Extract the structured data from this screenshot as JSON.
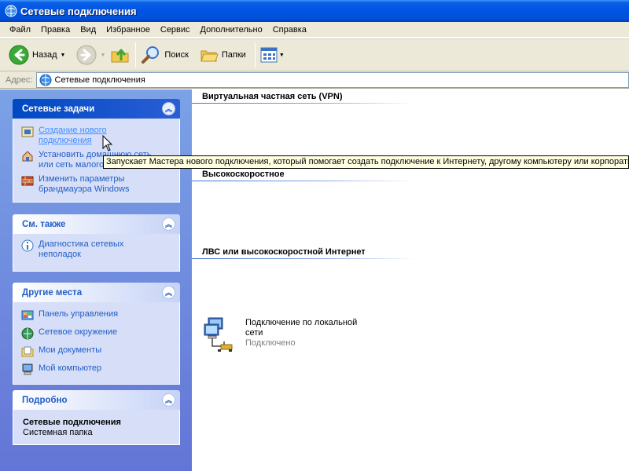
{
  "window": {
    "title": "Сетевые подключения"
  },
  "menu": [
    "Файл",
    "Правка",
    "Вид",
    "Избранное",
    "Сервис",
    "Дополнительно",
    "Справка"
  ],
  "toolbar": {
    "back_label": "Назад",
    "search_label": "Поиск",
    "folders_label": "Папки"
  },
  "address": {
    "label": "Адрес:",
    "value": "Сетевые подключения"
  },
  "network_tasks": {
    "title": "Сетевые задачи",
    "items": [
      {
        "label": "Создание нового подключения",
        "icon": "new-connection-icon"
      },
      {
        "label": "Установить домашнюю сеть или сеть малого офиса",
        "icon": "home-network-icon"
      },
      {
        "label": "Изменить параметры брандмауэра Windows",
        "icon": "firewall-icon"
      }
    ]
  },
  "see_also": {
    "title": "См. также",
    "items": [
      {
        "label": "Диагностика сетевых неполадок",
        "icon": "info-icon"
      }
    ]
  },
  "other_places": {
    "title": "Другие места",
    "items": [
      {
        "label": "Панель управления",
        "icon": "control-panel-icon"
      },
      {
        "label": "Сетевое окружение",
        "icon": "network-places-icon"
      },
      {
        "label": "Мои документы",
        "icon": "my-documents-icon"
      },
      {
        "label": "Мой компьютер",
        "icon": "my-computer-icon"
      }
    ]
  },
  "details": {
    "title": "Подробно",
    "name": "Сетевые подключения",
    "type": "Системная папка"
  },
  "groups": [
    "Виртуальная частная сеть (VPN)",
    "Высокоскоростное",
    "ЛВС или высокоскоростной Интернет"
  ],
  "connection": {
    "name": "Подключение по локальной сети",
    "status": "Подключено"
  },
  "tooltip": "Запускает Мастера нового подключения, который помогает создать подключение к Интернету, другому компьютеру или корпоративной сети.",
  "colors": {
    "titlebar": "#0054e3",
    "task_link": "#215dc6",
    "task_pane": "#7ba2e7",
    "tooltip_bg": "#ffffe1"
  }
}
